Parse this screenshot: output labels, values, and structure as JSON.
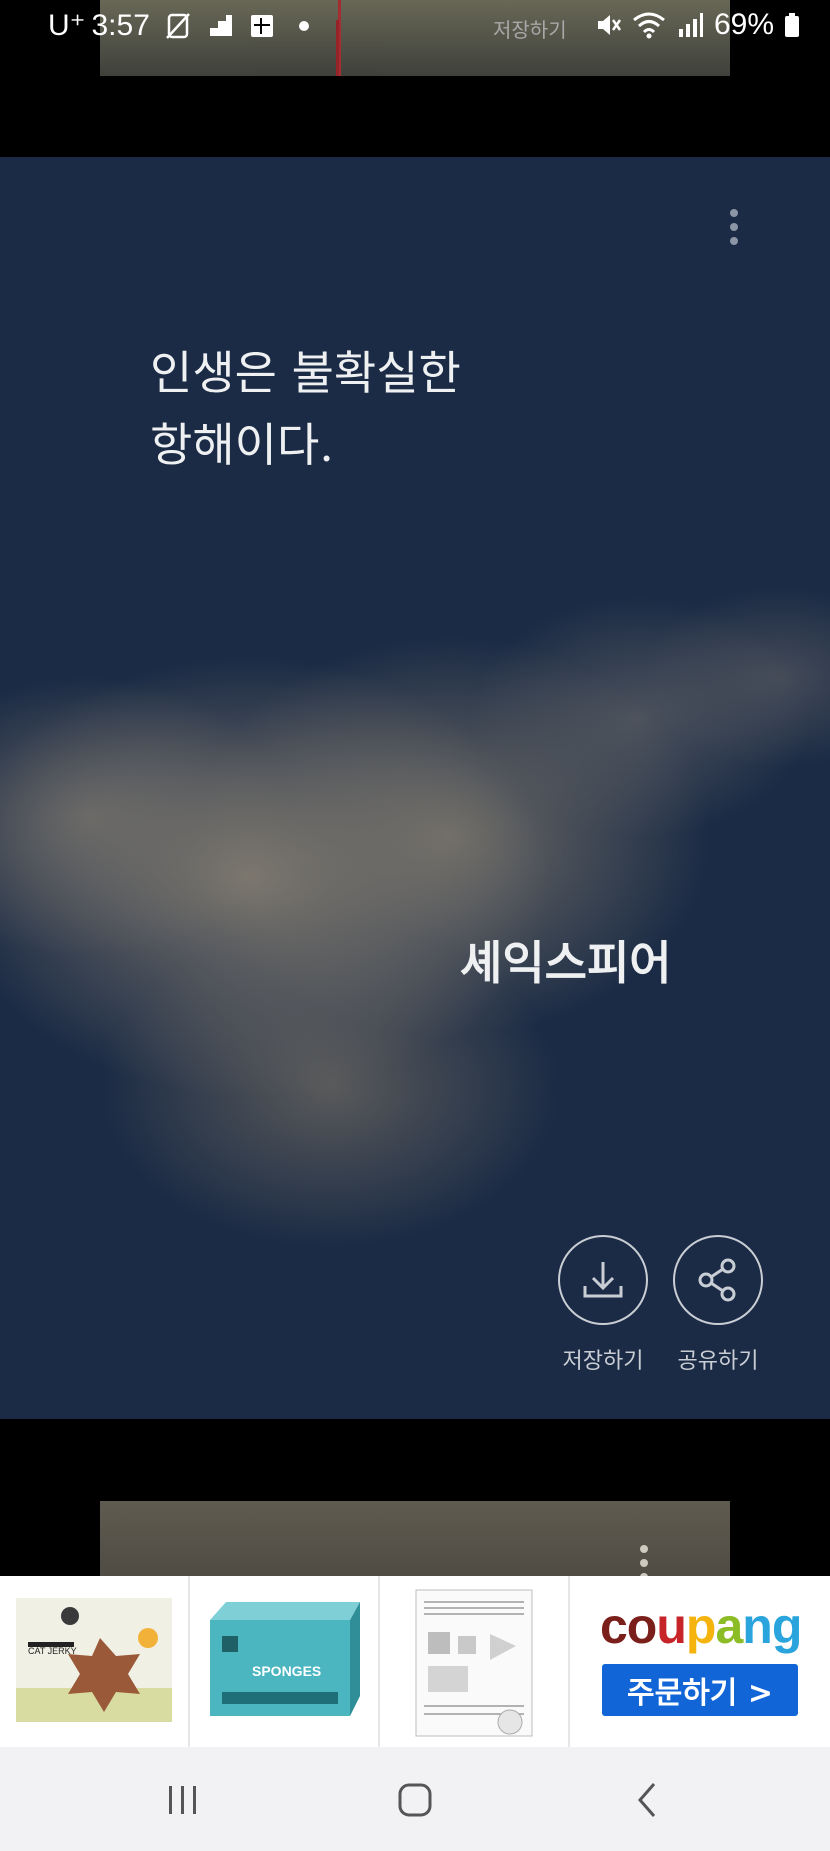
{
  "status_bar": {
    "carrier": "U⁺",
    "time": "3:57",
    "background_text": "저장하기",
    "battery": "69%"
  },
  "quote_card": {
    "quote": "인생은 불확실한\n 항해이다.",
    "author": "셰익스피어",
    "actions": {
      "save_label": "저장하기",
      "share_label": "공유하기"
    },
    "colors": {
      "sky": "#1b2b45",
      "text": "#eef0f2"
    }
  },
  "ad_banner": {
    "items": [
      {
        "name": "cat-jerky-product",
        "text": "CAT JERKY"
      },
      {
        "name": "sponges-product",
        "text": "SPONGES"
      },
      {
        "name": "wire-rack-product",
        "text": ""
      }
    ],
    "coupang": {
      "logo": "coupang",
      "order_button": "주문하기 >",
      "button_color": "#1265d6"
    }
  },
  "nav_bar": {
    "recent": "recent-apps-icon",
    "home": "home-icon",
    "back": "back-icon"
  }
}
